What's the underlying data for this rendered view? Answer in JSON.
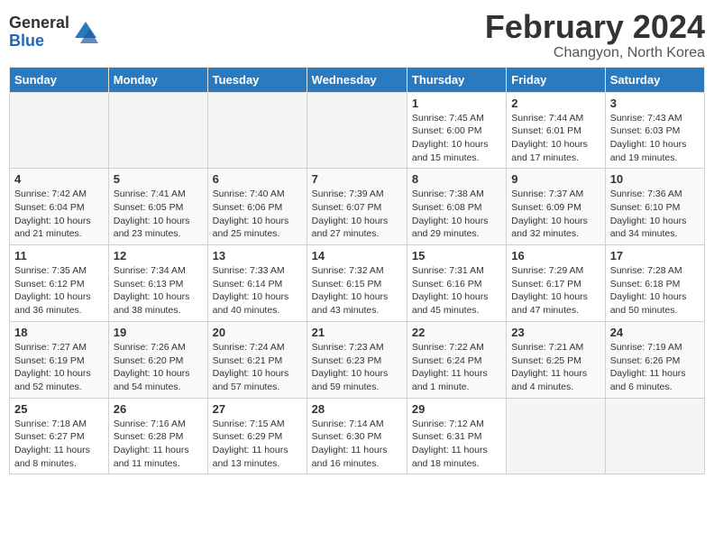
{
  "logo": {
    "general": "General",
    "blue": "Blue"
  },
  "title": "February 2024",
  "subtitle": "Changyon, North Korea",
  "weekdays": [
    "Sunday",
    "Monday",
    "Tuesday",
    "Wednesday",
    "Thursday",
    "Friday",
    "Saturday"
  ],
  "weeks": [
    [
      {
        "day": "",
        "info": ""
      },
      {
        "day": "",
        "info": ""
      },
      {
        "day": "",
        "info": ""
      },
      {
        "day": "",
        "info": ""
      },
      {
        "day": "1",
        "info": "Sunrise: 7:45 AM\nSunset: 6:00 PM\nDaylight: 10 hours\nand 15 minutes."
      },
      {
        "day": "2",
        "info": "Sunrise: 7:44 AM\nSunset: 6:01 PM\nDaylight: 10 hours\nand 17 minutes."
      },
      {
        "day": "3",
        "info": "Sunrise: 7:43 AM\nSunset: 6:03 PM\nDaylight: 10 hours\nand 19 minutes."
      }
    ],
    [
      {
        "day": "4",
        "info": "Sunrise: 7:42 AM\nSunset: 6:04 PM\nDaylight: 10 hours\nand 21 minutes."
      },
      {
        "day": "5",
        "info": "Sunrise: 7:41 AM\nSunset: 6:05 PM\nDaylight: 10 hours\nand 23 minutes."
      },
      {
        "day": "6",
        "info": "Sunrise: 7:40 AM\nSunset: 6:06 PM\nDaylight: 10 hours\nand 25 minutes."
      },
      {
        "day": "7",
        "info": "Sunrise: 7:39 AM\nSunset: 6:07 PM\nDaylight: 10 hours\nand 27 minutes."
      },
      {
        "day": "8",
        "info": "Sunrise: 7:38 AM\nSunset: 6:08 PM\nDaylight: 10 hours\nand 29 minutes."
      },
      {
        "day": "9",
        "info": "Sunrise: 7:37 AM\nSunset: 6:09 PM\nDaylight: 10 hours\nand 32 minutes."
      },
      {
        "day": "10",
        "info": "Sunrise: 7:36 AM\nSunset: 6:10 PM\nDaylight: 10 hours\nand 34 minutes."
      }
    ],
    [
      {
        "day": "11",
        "info": "Sunrise: 7:35 AM\nSunset: 6:12 PM\nDaylight: 10 hours\nand 36 minutes."
      },
      {
        "day": "12",
        "info": "Sunrise: 7:34 AM\nSunset: 6:13 PM\nDaylight: 10 hours\nand 38 minutes."
      },
      {
        "day": "13",
        "info": "Sunrise: 7:33 AM\nSunset: 6:14 PM\nDaylight: 10 hours\nand 40 minutes."
      },
      {
        "day": "14",
        "info": "Sunrise: 7:32 AM\nSunset: 6:15 PM\nDaylight: 10 hours\nand 43 minutes."
      },
      {
        "day": "15",
        "info": "Sunrise: 7:31 AM\nSunset: 6:16 PM\nDaylight: 10 hours\nand 45 minutes."
      },
      {
        "day": "16",
        "info": "Sunrise: 7:29 AM\nSunset: 6:17 PM\nDaylight: 10 hours\nand 47 minutes."
      },
      {
        "day": "17",
        "info": "Sunrise: 7:28 AM\nSunset: 6:18 PM\nDaylight: 10 hours\nand 50 minutes."
      }
    ],
    [
      {
        "day": "18",
        "info": "Sunrise: 7:27 AM\nSunset: 6:19 PM\nDaylight: 10 hours\nand 52 minutes."
      },
      {
        "day": "19",
        "info": "Sunrise: 7:26 AM\nSunset: 6:20 PM\nDaylight: 10 hours\nand 54 minutes."
      },
      {
        "day": "20",
        "info": "Sunrise: 7:24 AM\nSunset: 6:21 PM\nDaylight: 10 hours\nand 57 minutes."
      },
      {
        "day": "21",
        "info": "Sunrise: 7:23 AM\nSunset: 6:23 PM\nDaylight: 10 hours\nand 59 minutes."
      },
      {
        "day": "22",
        "info": "Sunrise: 7:22 AM\nSunset: 6:24 PM\nDaylight: 11 hours\nand 1 minute."
      },
      {
        "day": "23",
        "info": "Sunrise: 7:21 AM\nSunset: 6:25 PM\nDaylight: 11 hours\nand 4 minutes."
      },
      {
        "day": "24",
        "info": "Sunrise: 7:19 AM\nSunset: 6:26 PM\nDaylight: 11 hours\nand 6 minutes."
      }
    ],
    [
      {
        "day": "25",
        "info": "Sunrise: 7:18 AM\nSunset: 6:27 PM\nDaylight: 11 hours\nand 8 minutes."
      },
      {
        "day": "26",
        "info": "Sunrise: 7:16 AM\nSunset: 6:28 PM\nDaylight: 11 hours\nand 11 minutes."
      },
      {
        "day": "27",
        "info": "Sunrise: 7:15 AM\nSunset: 6:29 PM\nDaylight: 11 hours\nand 13 minutes."
      },
      {
        "day": "28",
        "info": "Sunrise: 7:14 AM\nSunset: 6:30 PM\nDaylight: 11 hours\nand 16 minutes."
      },
      {
        "day": "29",
        "info": "Sunrise: 7:12 AM\nSunset: 6:31 PM\nDaylight: 11 hours\nand 18 minutes."
      },
      {
        "day": "",
        "info": ""
      },
      {
        "day": "",
        "info": ""
      }
    ]
  ]
}
